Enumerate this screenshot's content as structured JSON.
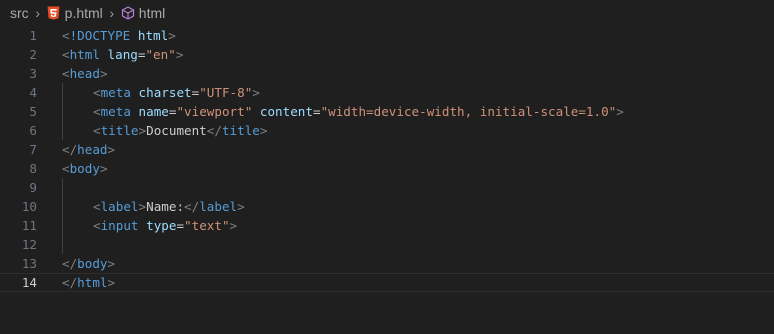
{
  "breadcrumb": {
    "folder": "src",
    "file": "p.html",
    "symbol": "html"
  },
  "colors": {
    "background": "#1f1f1f",
    "tag": "#569cd6",
    "bracket": "#808080",
    "attribute": "#9cdcfe",
    "string": "#ce9178",
    "text": "#cccccc",
    "line_number": "#6e7681",
    "html5_icon": "#e44d26"
  },
  "editor": {
    "current_line": 14,
    "lines": [
      {
        "n": "1",
        "tokens": [
          [
            "punc",
            "<"
          ],
          [
            "tag",
            "!DOCTYPE"
          ],
          [
            "txt",
            " "
          ],
          [
            "attr",
            "html"
          ],
          [
            "punc",
            ">"
          ]
        ]
      },
      {
        "n": "2",
        "tokens": [
          [
            "punc",
            "<"
          ],
          [
            "tag",
            "html"
          ],
          [
            "txt",
            " "
          ],
          [
            "attr",
            "lang"
          ],
          [
            "eq",
            "="
          ],
          [
            "str",
            "\"en\""
          ],
          [
            "punc",
            ">"
          ]
        ]
      },
      {
        "n": "3",
        "tokens": [
          [
            "punc",
            "<"
          ],
          [
            "tag",
            "head"
          ],
          [
            "punc",
            ">"
          ]
        ]
      },
      {
        "n": "4",
        "indent": 1,
        "tokens": [
          [
            "punc",
            "<"
          ],
          [
            "tag",
            "meta"
          ],
          [
            "txt",
            " "
          ],
          [
            "attr",
            "charset"
          ],
          [
            "eq",
            "="
          ],
          [
            "str",
            "\"UTF-8\""
          ],
          [
            "punc",
            ">"
          ]
        ]
      },
      {
        "n": "5",
        "indent": 1,
        "tokens": [
          [
            "punc",
            "<"
          ],
          [
            "tag",
            "meta"
          ],
          [
            "txt",
            " "
          ],
          [
            "attr",
            "name"
          ],
          [
            "eq",
            "="
          ],
          [
            "str",
            "\"viewport\""
          ],
          [
            "txt",
            " "
          ],
          [
            "attr",
            "content"
          ],
          [
            "eq",
            "="
          ],
          [
            "str",
            "\"width=device-width, initial-scale=1.0\""
          ],
          [
            "punc",
            ">"
          ]
        ]
      },
      {
        "n": "6",
        "indent": 1,
        "tokens": [
          [
            "punc",
            "<"
          ],
          [
            "tag",
            "title"
          ],
          [
            "punc",
            ">"
          ],
          [
            "txt",
            "Document"
          ],
          [
            "punc",
            "</"
          ],
          [
            "tag",
            "title"
          ],
          [
            "punc",
            ">"
          ]
        ]
      },
      {
        "n": "7",
        "tokens": [
          [
            "punc",
            "</"
          ],
          [
            "tag",
            "head"
          ],
          [
            "punc",
            ">"
          ]
        ]
      },
      {
        "n": "8",
        "tokens": [
          [
            "punc",
            "<"
          ],
          [
            "tag",
            "body"
          ],
          [
            "punc",
            ">"
          ]
        ]
      },
      {
        "n": "9",
        "guide": true,
        "tokens": []
      },
      {
        "n": "10",
        "indent": 1,
        "tokens": [
          [
            "punc",
            "<"
          ],
          [
            "tag",
            "label"
          ],
          [
            "punc",
            ">"
          ],
          [
            "txt",
            "Name:"
          ],
          [
            "punc",
            "</"
          ],
          [
            "tag",
            "label"
          ],
          [
            "punc",
            ">"
          ]
        ]
      },
      {
        "n": "11",
        "indent": 1,
        "tokens": [
          [
            "punc",
            "<"
          ],
          [
            "tag",
            "input"
          ],
          [
            "txt",
            " "
          ],
          [
            "attr",
            "type"
          ],
          [
            "eq",
            "="
          ],
          [
            "str",
            "\"text\""
          ],
          [
            "punc",
            ">"
          ]
        ]
      },
      {
        "n": "12",
        "guide": true,
        "tokens": []
      },
      {
        "n": "13",
        "tokens": [
          [
            "punc",
            "</"
          ],
          [
            "tag",
            "body"
          ],
          [
            "punc",
            ">"
          ]
        ]
      },
      {
        "n": "14",
        "tokens": [
          [
            "punc",
            "</"
          ],
          [
            "tag",
            "html"
          ],
          [
            "punc",
            ">"
          ]
        ]
      }
    ]
  }
}
